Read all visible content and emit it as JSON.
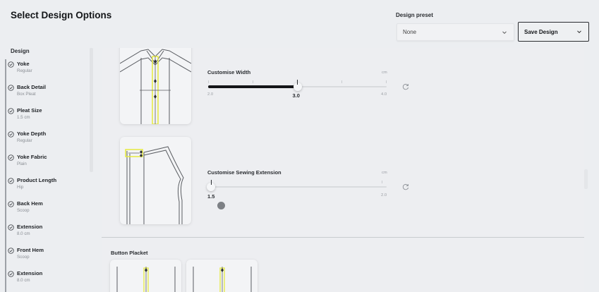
{
  "header": {
    "title": "Select Design Options",
    "preset_label": "Design preset",
    "preset_value": "None",
    "save_label": "Save Design"
  },
  "sidebar": {
    "title": "Design",
    "items": [
      {
        "name": "Yoke",
        "value": "Regular"
      },
      {
        "name": "Back Detail",
        "value": "Box Pleat"
      },
      {
        "name": "Pleat Size",
        "value": "1.5 cm"
      },
      {
        "name": "Yoke Depth",
        "value": "Regular"
      },
      {
        "name": "Yoke Fabric",
        "value": "Plain"
      },
      {
        "name": "Product Length",
        "value": "Hip"
      },
      {
        "name": "Back Hem",
        "value": "Scoop"
      },
      {
        "name": "Extension",
        "value": "8.0 cm"
      },
      {
        "name": "Front Hem",
        "value": "Scoop"
      },
      {
        "name": "Extension",
        "value": "8.0 cm"
      }
    ]
  },
  "controls": {
    "width": {
      "label": "Customise Width",
      "unit": "cm",
      "min_label": "2.0",
      "max_label": "4.0",
      "value_label": "3.0",
      "min": 2.0,
      "max": 4.0,
      "value": 3.0
    },
    "sewing": {
      "label": "Customise Sewing Extension",
      "unit": "cm",
      "min_label": "",
      "max_label": "2.0",
      "value_label": "1.5",
      "min": 1.5,
      "max": 2.0,
      "value": 1.5
    }
  },
  "section": {
    "button_placket": "Button Placket"
  },
  "colors": {
    "accent_highlight": "#e6ea3f",
    "slider_fill": "#141518",
    "background": "#eceef1"
  },
  "icons": {
    "check": "check-circle-icon",
    "chevron": "chevron-down-icon",
    "reset": "reset-icon"
  }
}
